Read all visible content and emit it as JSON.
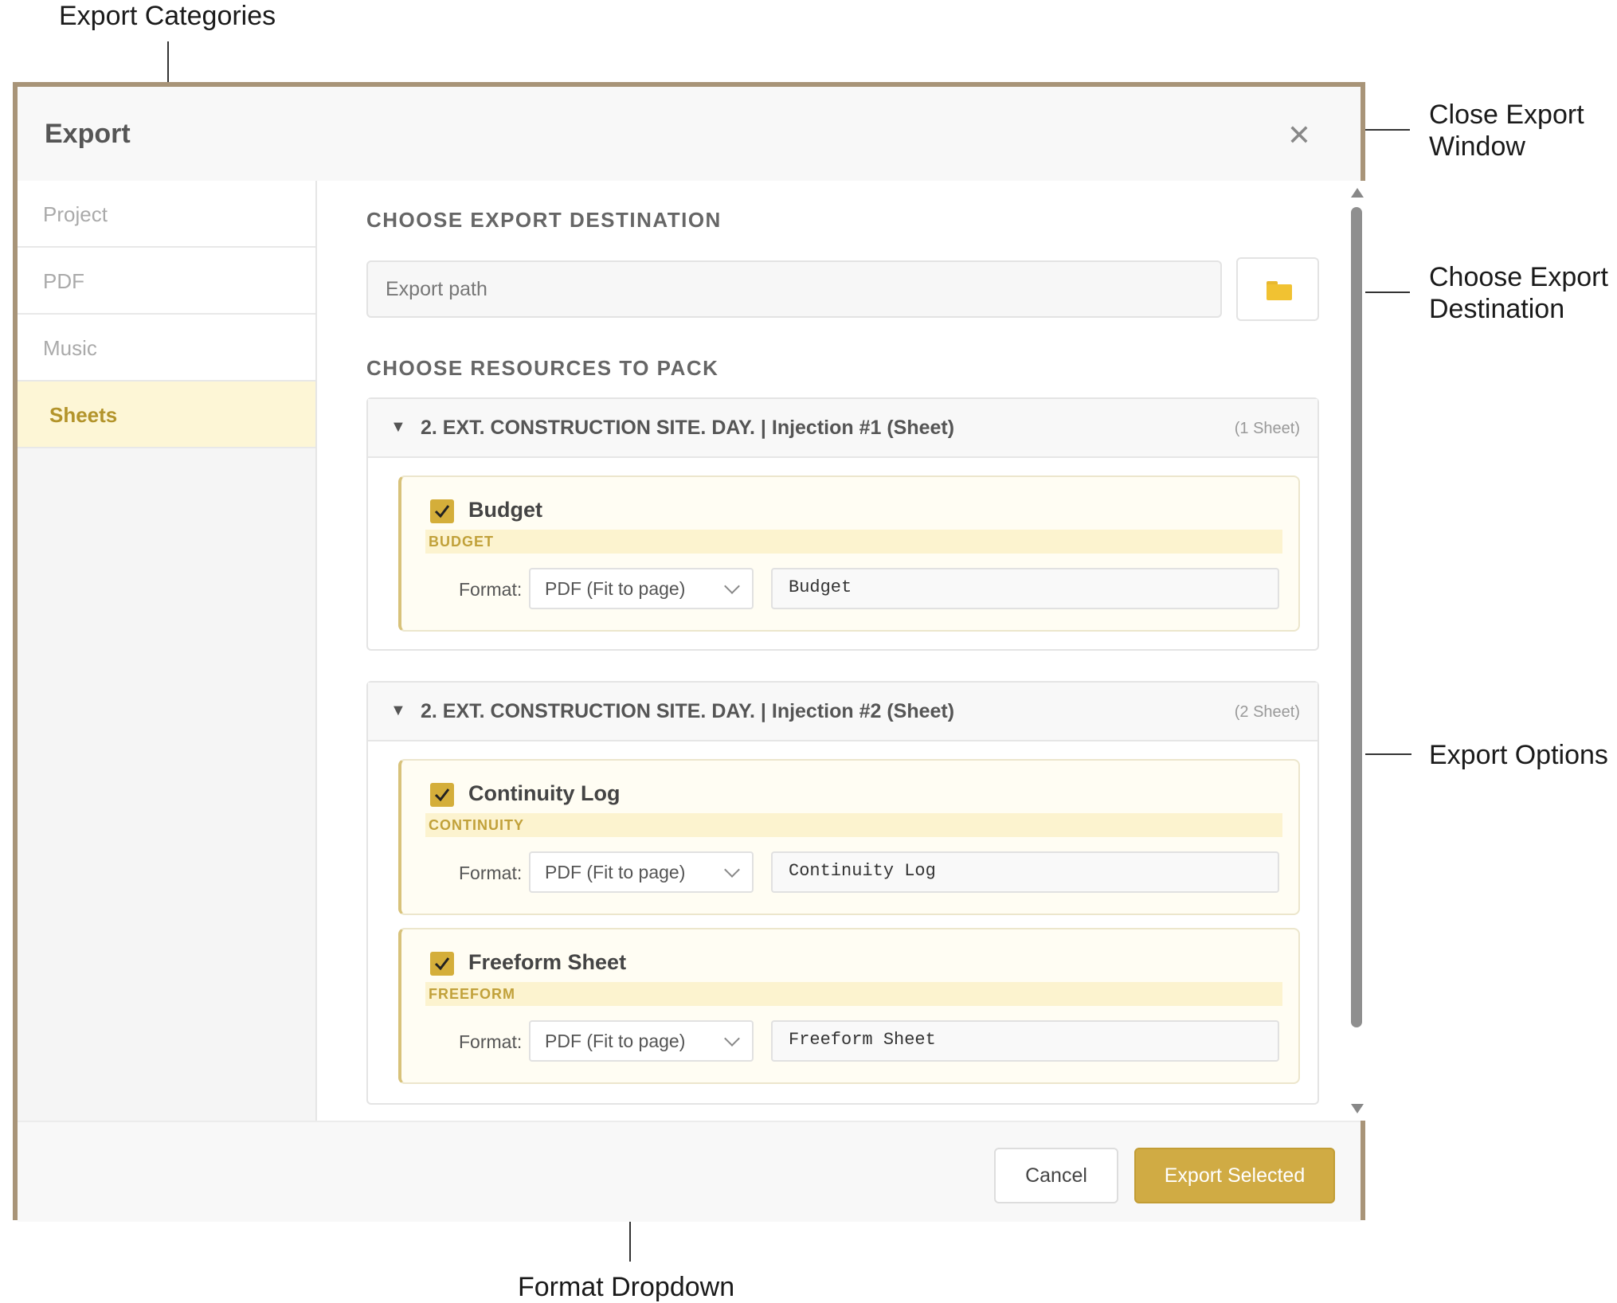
{
  "annotations": {
    "export_categories": "Export Categories",
    "close_window_line1": "Close Export",
    "close_window_line2": "Window",
    "choose_dest_line1": "Choose Export",
    "choose_dest_line2": "Destination",
    "export_options": "Export Options",
    "format_dropdown": "Format Dropdown"
  },
  "dialog": {
    "title": "Export",
    "close_icon": "close-icon"
  },
  "sidebar": {
    "items": [
      {
        "label": "Project",
        "active": false
      },
      {
        "label": "PDF",
        "active": false
      },
      {
        "label": "Music",
        "active": false
      },
      {
        "label": "Sheets",
        "active": true
      }
    ]
  },
  "destination": {
    "heading": "CHOOSE EXPORT DESTINATION",
    "placeholder": "Export path",
    "folder_icon": "folder-icon"
  },
  "resources": {
    "heading": "CHOOSE RESOURCES TO PACK",
    "groups": [
      {
        "title": "2. EXT. CONSTRUCTION SITE. DAY. | Injection #1 (Sheet)",
        "count": "(1 Sheet)",
        "items": [
          {
            "name": "Budget",
            "tag": "BUDGET",
            "format_label": "Format:",
            "format": "PDF (Fit to page)",
            "filename": "Budget",
            "checked": true
          }
        ]
      },
      {
        "title": "2. EXT. CONSTRUCTION SITE. DAY. | Injection #2 (Sheet)",
        "count": "(2 Sheet)",
        "items": [
          {
            "name": "Continuity Log",
            "tag": "CONTINUITY",
            "format_label": "Format:",
            "format": "PDF (Fit to page)",
            "filename": "Continuity Log",
            "checked": true
          },
          {
            "name": "Freeform Sheet",
            "tag": "FREEFORM",
            "format_label": "Format:",
            "format": "PDF (Fit to page)",
            "filename": "Freeform Sheet",
            "checked": true
          }
        ]
      }
    ]
  },
  "footer": {
    "cancel_label": "Cancel",
    "export_label": "Export Selected"
  },
  "colors": {
    "accent": "#d0ab44",
    "active_bg": "#fdf6d6",
    "frame": "#a89478"
  }
}
